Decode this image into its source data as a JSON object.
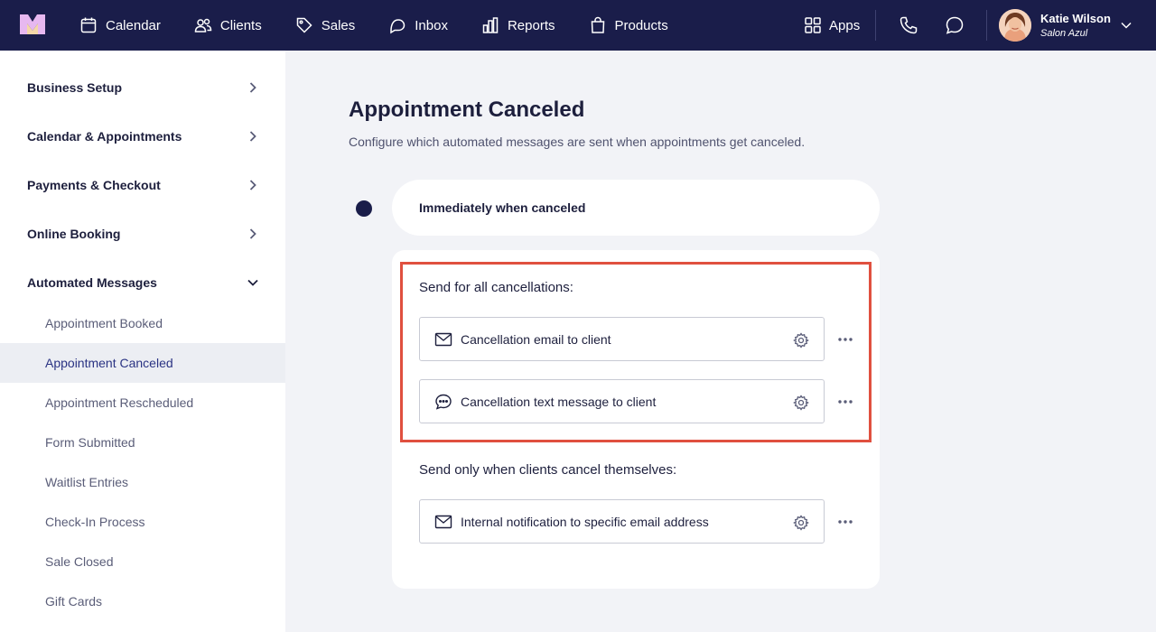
{
  "nav": {
    "items": [
      {
        "label": "Calendar",
        "icon": "calendar-icon"
      },
      {
        "label": "Clients",
        "icon": "users-icon"
      },
      {
        "label": "Sales",
        "icon": "tag-icon"
      },
      {
        "label": "Inbox",
        "icon": "inbox-icon"
      },
      {
        "label": "Reports",
        "icon": "bar-chart-icon"
      },
      {
        "label": "Products",
        "icon": "bag-icon"
      }
    ],
    "apps_label": "Apps",
    "user": {
      "name": "Katie Wilson",
      "business": "Salon Azul"
    }
  },
  "sidebar": {
    "sections": [
      {
        "label": "Business Setup",
        "expanded": false
      },
      {
        "label": "Calendar & Appointments",
        "expanded": false
      },
      {
        "label": "Payments & Checkout",
        "expanded": false
      },
      {
        "label": "Online Booking",
        "expanded": false
      },
      {
        "label": "Automated Messages",
        "expanded": true
      }
    ],
    "items": [
      {
        "label": "Appointment Booked"
      },
      {
        "label": "Appointment Canceled",
        "active": true
      },
      {
        "label": "Appointment Rescheduled"
      },
      {
        "label": "Form Submitted"
      },
      {
        "label": "Waitlist Entries"
      },
      {
        "label": "Check-In Process"
      },
      {
        "label": "Sale Closed"
      },
      {
        "label": "Gift Cards"
      }
    ]
  },
  "main": {
    "title": "Appointment Canceled",
    "description": "Configure which automated messages are sent when appointments get canceled.",
    "trigger": "Immediately when canceled",
    "groups": [
      {
        "label": "Send for all cancellations:",
        "messages": [
          {
            "label": "Cancellation email to client",
            "icon": "mail-icon"
          },
          {
            "label": "Cancellation text message to client",
            "icon": "chat-bubble-icon"
          }
        ]
      },
      {
        "label": "Send only when clients cancel themselves:",
        "messages": [
          {
            "label": "Internal notification to specific email address",
            "icon": "mail-icon"
          }
        ]
      }
    ]
  },
  "colors": {
    "nav_bg": "#1a1d4a",
    "page_bg": "#f2f3f7",
    "highlight_border": "#e0503f",
    "active_item_text": "#2a3383"
  }
}
